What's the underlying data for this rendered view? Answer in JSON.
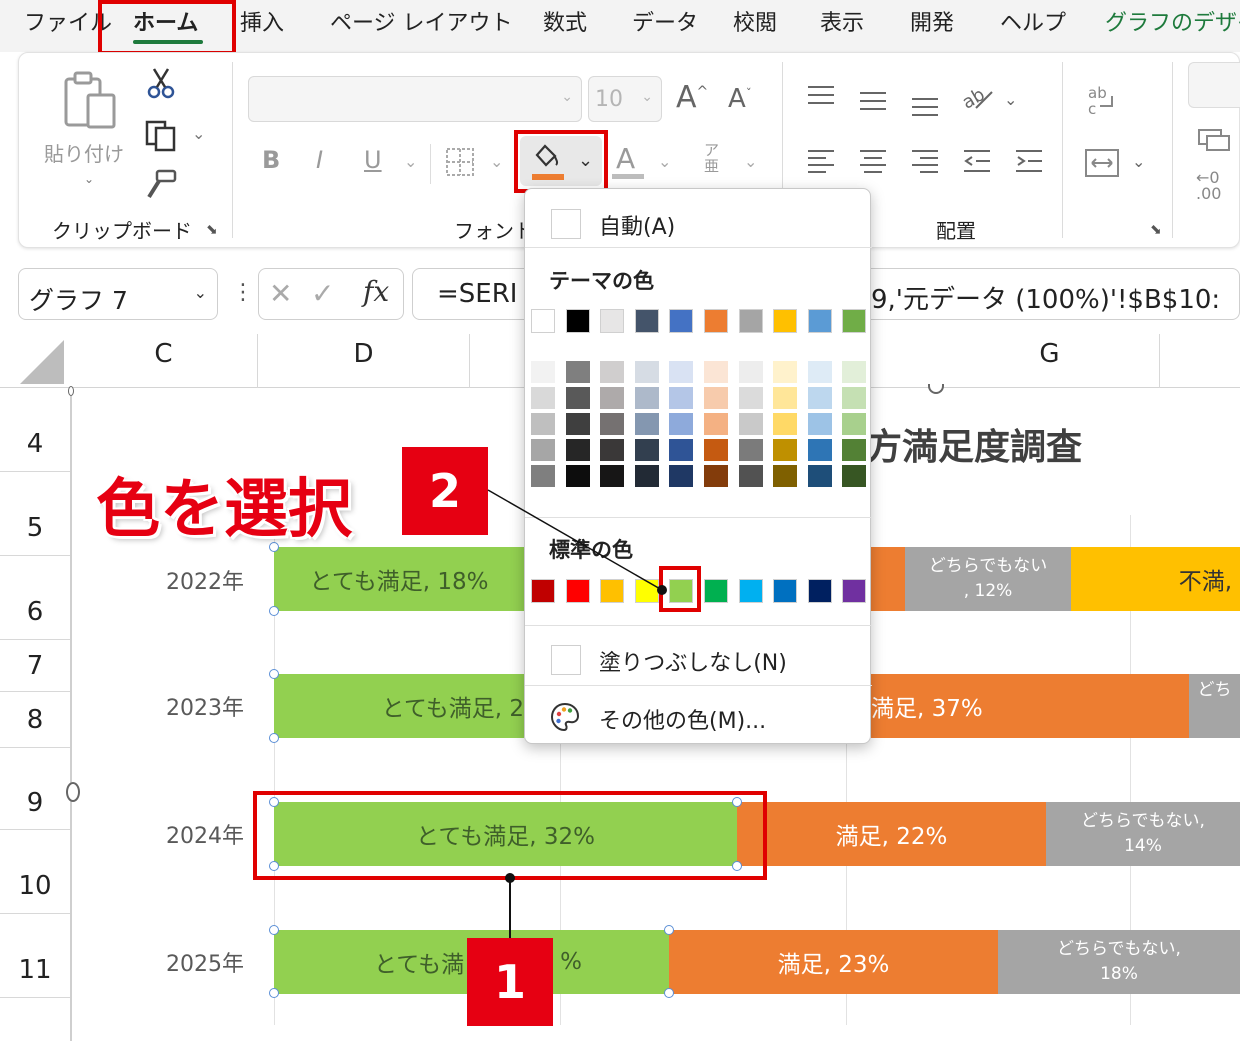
{
  "menu": {
    "tabs": [
      "ファイル",
      "ホーム",
      "挿入",
      "ページ レイアウト",
      "数式",
      "データ",
      "校閲",
      "表示",
      "開発",
      "ヘルプ",
      "グラフのデザイ"
    ],
    "active_tab": "ホーム"
  },
  "ribbon": {
    "clipboard": {
      "paste_label": "貼り付け",
      "group_label": "クリップボード"
    },
    "font": {
      "group_label": "フォント",
      "font_size": "10",
      "bold": "B",
      "italic": "I",
      "underline": "U",
      "font_color": "A",
      "grow_font": "A",
      "shrink_font": "A",
      "phonetic_top": "ア",
      "phonetic_bottom": "亜"
    },
    "alignment": {
      "group_label": "配置"
    },
    "wrap_label": "ab"
  },
  "formula_bar": {
    "name_box": "グラフ 7",
    "fx": "fx",
    "formula_left": "=SERI",
    "formula_right": "9,'元データ (100%)'!$B$10:"
  },
  "columns": [
    "C",
    "D",
    "G"
  ],
  "rows": [
    "4",
    "5",
    "6",
    "7",
    "8",
    "9",
    "10",
    "11"
  ],
  "chart": {
    "title": "方満足度調査",
    "years": [
      "2022年",
      "2023年",
      "2024年",
      "2025年"
    ],
    "bars": [
      {
        "year": "2022年",
        "segments": [
          {
            "label": "とても満足, 18%",
            "color": "#92d050"
          },
          {
            "label": "",
            "color": "#ed7d31"
          },
          {
            "label": "どちらでもない",
            "label2": ", 12%",
            "color": "#a5a5a5"
          },
          {
            "label": "不満,",
            "color": "#ffc000"
          }
        ]
      },
      {
        "year": "2023年",
        "segments": [
          {
            "label": "とても満足, 2",
            "color": "#92d050"
          },
          {
            "label": "満足, 37%",
            "color": "#ed7d31"
          },
          {
            "label": "どち",
            "color": "#a5a5a5"
          }
        ]
      },
      {
        "year": "2024年",
        "segments": [
          {
            "label": "とても満足, 32%",
            "color": "#92d050"
          },
          {
            "label": "満足, 22%",
            "color": "#ed7d31"
          },
          {
            "label": "どちらでもない,",
            "label2": "14%",
            "color": "#a5a5a5"
          }
        ]
      },
      {
        "year": "2025年",
        "segments": [
          {
            "label": "とても満",
            "label_tail": "%",
            "color": "#92d050"
          },
          {
            "label": "満足, 23%",
            "color": "#ed7d31"
          },
          {
            "label": "どちらでもない,",
            "label2": "18%",
            "color": "#a5a5a5"
          }
        ]
      }
    ]
  },
  "annotations": {
    "instruction": "色を選択",
    "step1": "1",
    "step2": "2",
    "frame_color": "#e00000"
  },
  "color_menu": {
    "automatic": "自動(A)",
    "theme_heading": "テーマの色",
    "standard_heading": "標準の色",
    "no_fill": "塗りつぶしなし(N)",
    "more_colors": "その他の色(M)...",
    "theme_colors": [
      "#ffffff",
      "#000000",
      "#e7e6e6",
      "#44546a",
      "#4472c4",
      "#ed7d31",
      "#a5a5a5",
      "#ffc000",
      "#5b9bd5",
      "#70ad47"
    ],
    "theme_tints": [
      [
        "#f2f2f2",
        "#d9d9d9",
        "#bfbfbf",
        "#a6a6a6",
        "#7f7f7f"
      ],
      [
        "#7f7f7f",
        "#595959",
        "#3f3f3f",
        "#262626",
        "#0d0d0d"
      ],
      [
        "#d0cece",
        "#aeaaaa",
        "#757171",
        "#3a3838",
        "#171616"
      ],
      [
        "#d6dce4",
        "#adb9ca",
        "#8497b0",
        "#323f4f",
        "#222a35"
      ],
      [
        "#d9e2f3",
        "#b4c6e7",
        "#8eaadb",
        "#2f5496",
        "#1f3864"
      ],
      [
        "#fbe5d5",
        "#f7cbac",
        "#f4b183",
        "#c55a11",
        "#833c0b"
      ],
      [
        "#ededed",
        "#dbdbdb",
        "#c9c9c9",
        "#7b7b7b",
        "#525252"
      ],
      [
        "#fff2cc",
        "#ffe699",
        "#ffd966",
        "#bf9000",
        "#7f6000"
      ],
      [
        "#deebf6",
        "#bdd7ee",
        "#9dc3e6",
        "#2e75b5",
        "#1e4e79"
      ],
      [
        "#e2efd9",
        "#c5e0b3",
        "#a8d08d",
        "#538135",
        "#375623"
      ]
    ],
    "standard_colors": [
      "#c00000",
      "#ff0000",
      "#ffc000",
      "#ffff00",
      "#92d050",
      "#00b050",
      "#00b0f0",
      "#0070c0",
      "#002060",
      "#7030a0"
    ],
    "selected_standard": "#92d050"
  }
}
